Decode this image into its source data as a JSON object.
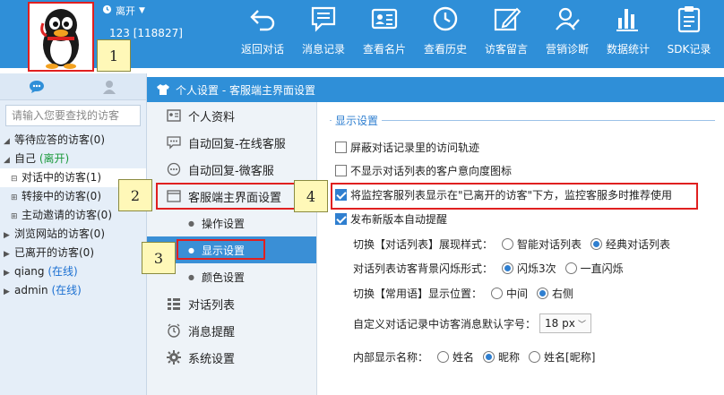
{
  "user": {
    "status": "离开",
    "id": "123 [118827]"
  },
  "toolbar": [
    {
      "label": "返回对话",
      "icon": "back-arrow-icon"
    },
    {
      "label": "消息记录",
      "icon": "message-record-icon"
    },
    {
      "label": "查看名片",
      "icon": "business-card-icon"
    },
    {
      "label": "查看历史",
      "icon": "history-clock-icon"
    },
    {
      "label": "访客留言",
      "icon": "edit-note-icon"
    },
    {
      "label": "营销诊断",
      "icon": "diagnosis-icon"
    },
    {
      "label": "数据统计",
      "icon": "bar-chart-icon"
    },
    {
      "label": "SDK记录",
      "icon": "clipboard-icon"
    }
  ],
  "callouts": [
    "1",
    "2",
    "3",
    "4"
  ],
  "left": {
    "search_placeholder": "请输入您要查找的访客",
    "tree": {
      "waiting": "等待应答的访客(0)",
      "self": "自己",
      "self_status": "(离开)",
      "in_chat": "对话中的访客(1)",
      "transfer": "转接中的访客(0)",
      "invite": "主动邀请的访客(0)",
      "browsing": "浏览网站的访客(0)",
      "left": "已离开的访客(0)",
      "qiang": "qiang",
      "qiang_status": "(在线)",
      "admin": "admin",
      "admin_status": "(在线)"
    }
  },
  "header": {
    "breadcrumb": "个人设置 - 客服端主界面设置"
  },
  "nav": {
    "profile": "个人资料",
    "auto_online": "自动回复-在线客服",
    "auto_wechat": "自动回复-微客服",
    "main_ui": "客服端主界面设置",
    "operation": "操作设置",
    "display": "显示设置",
    "color": "颜色设置",
    "chat_list": "对话列表",
    "msg_notify": "消息提醒",
    "system": "系统设置"
  },
  "display": {
    "title": "显示设置",
    "opt1": "屏蔽对话记录里的访问轨迹",
    "opt2": "不显示对话列表的客户意向度图标",
    "opt3": "将监控客服列表显示在\"已离开的访客\"下方，监控客服多时推荐使用",
    "opt4": "发布新版本自动提醒",
    "style_label": "切换【对话列表】展现样式：",
    "style_a": "智能对话列表",
    "style_b": "经典对话列表",
    "blink_label": "对话列表访客背景闪烁形式：",
    "blink_a": "闪烁3次",
    "blink_b": "一直闪烁",
    "phrase_label": "切换【常用语】显示位置：",
    "phrase_a": "中间",
    "phrase_b": "右侧",
    "font_label": "自定义对话记录中访客消息默认字号：",
    "font_value": "18 px",
    "name_label": "内部显示名称：",
    "name_a": "姓名",
    "name_b": "昵称",
    "name_c": "姓名[昵称]"
  }
}
